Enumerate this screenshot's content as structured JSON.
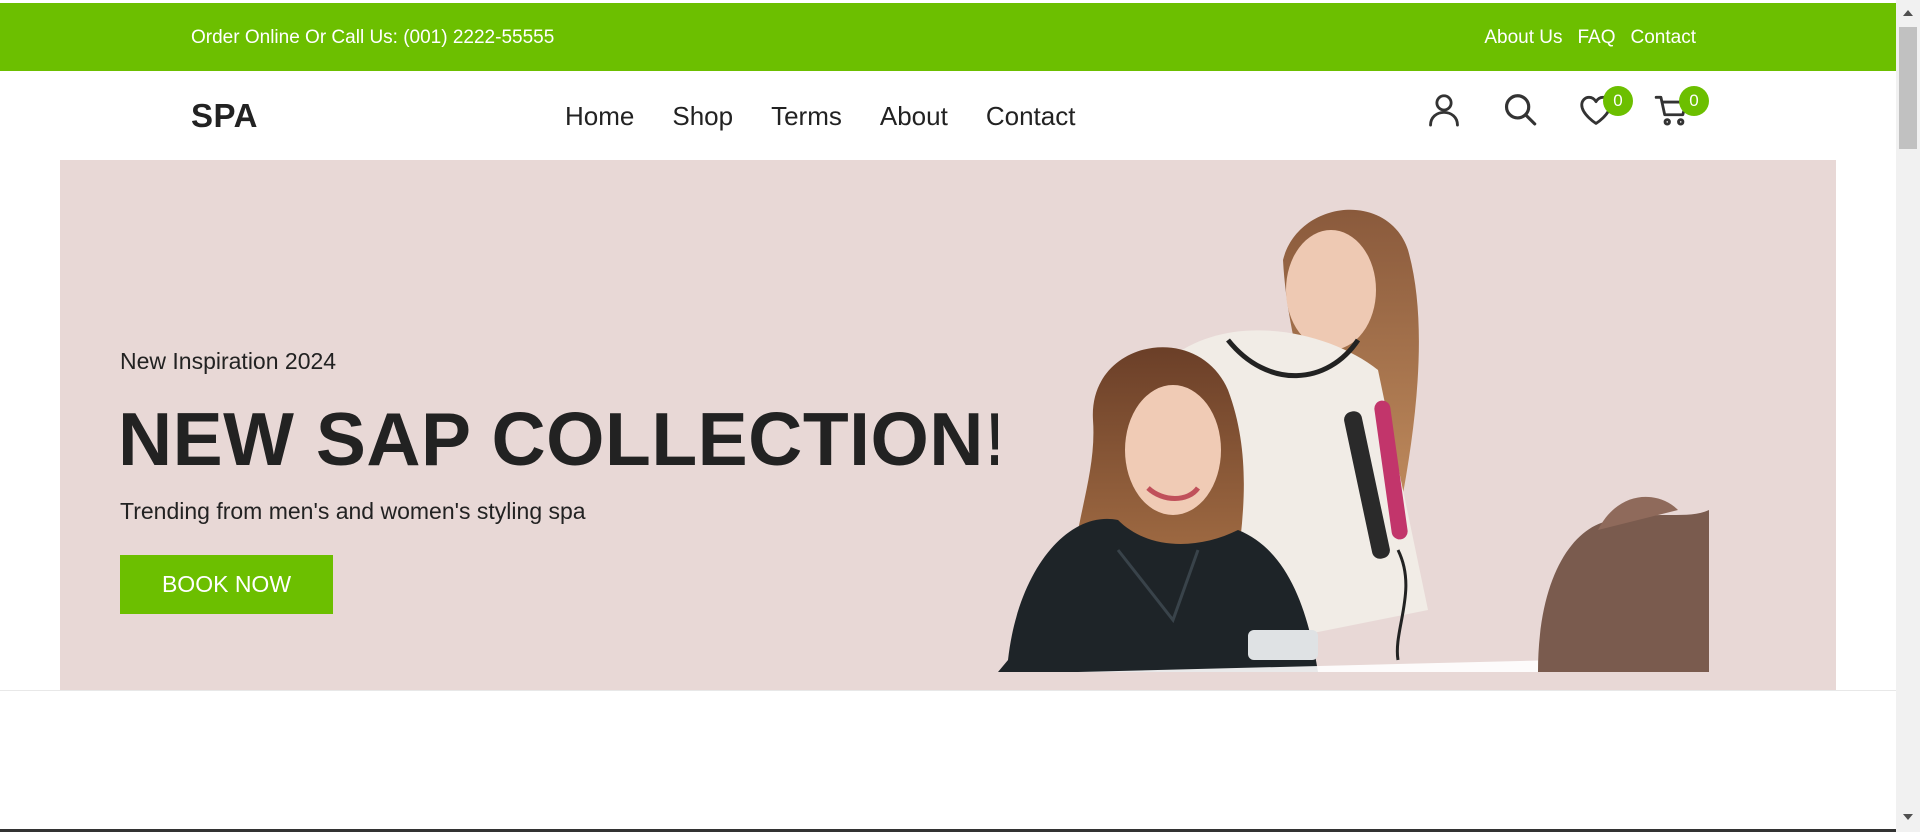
{
  "topbar": {
    "phone_text": "Order Online Or Call Us: (001) 2222-55555",
    "links": [
      "About Us",
      "FAQ",
      "Contact"
    ],
    "color": "#6cbf00"
  },
  "header": {
    "logo": "SPA",
    "nav": [
      "Home",
      "Shop",
      "Terms",
      "About",
      "Contact"
    ],
    "icons": [
      "user-icon",
      "search-icon",
      "heart-icon",
      "cart-icon"
    ],
    "wishlist_count": "0",
    "cart_count": "0"
  },
  "hero": {
    "eyebrow": "New Inspiration 2024",
    "title": "NEW SAP COLLECTION!",
    "subtitle": "Trending from men's and women's styling spa",
    "button_label": "BOOK NOW",
    "background": "#e8d8d6",
    "image": "hairdresser-styling-client-photo"
  }
}
